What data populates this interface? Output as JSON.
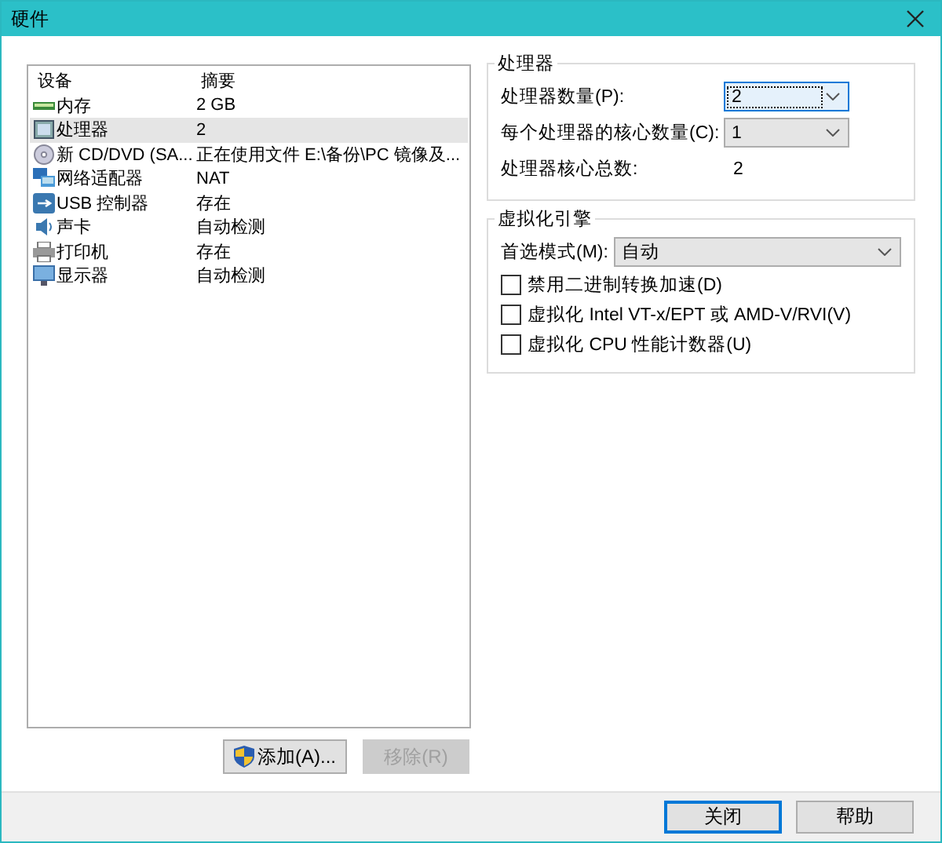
{
  "window": {
    "title": "硬件"
  },
  "device_list": {
    "columns": [
      "设备",
      "摘要"
    ],
    "rows": [
      {
        "kind": "memory",
        "name": "内存",
        "summary": "2 GB",
        "selected": false
      },
      {
        "kind": "cpu",
        "name": "处理器",
        "summary": "2",
        "selected": true
      },
      {
        "kind": "disc",
        "name": "新 CD/DVD (SA...",
        "summary": "正在使用文件 E:\\备份\\PC 镜像及...",
        "selected": false
      },
      {
        "kind": "network",
        "name": "网络适配器",
        "summary": "NAT",
        "selected": false
      },
      {
        "kind": "usb",
        "name": "USB 控制器",
        "summary": "存在",
        "selected": false
      },
      {
        "kind": "sound",
        "name": "声卡",
        "summary": "自动检测",
        "selected": false
      },
      {
        "kind": "printer",
        "name": "打印机",
        "summary": "存在",
        "selected": false
      },
      {
        "kind": "display",
        "name": "显示器",
        "summary": "自动检测",
        "selected": false
      }
    ]
  },
  "processor": {
    "title": "处理器",
    "rows": [
      {
        "kind": "dropdown",
        "label": "处理器数量(P):",
        "value": "2",
        "focused": true
      },
      {
        "kind": "dropdown",
        "label": "每个处理器的核心数量(C):",
        "value": "1",
        "focused": false
      },
      {
        "kind": "text",
        "label": "处理器核心总数:",
        "value": "2"
      }
    ]
  },
  "virtualization": {
    "title": "虚拟化引擎",
    "mode_label": "首选模式(M):",
    "mode_value": "自动",
    "options": [
      {
        "label": "禁用二进制转换加速(D)",
        "checked": false
      },
      {
        "label": "虚拟化 Intel VT-x/EPT 或 AMD-V/RVI(V)",
        "checked": false
      },
      {
        "label": "虚拟化 CPU 性能计数器(U)",
        "checked": false
      }
    ]
  },
  "list_buttons": [
    {
      "label": "添加(A)...",
      "shield": true,
      "disabled": false
    },
    {
      "label": "移除(R)",
      "shield": false,
      "disabled": true
    }
  ],
  "dialog_buttons": [
    {
      "label": "关闭",
      "default": true
    },
    {
      "label": "帮助",
      "default": false
    }
  ]
}
